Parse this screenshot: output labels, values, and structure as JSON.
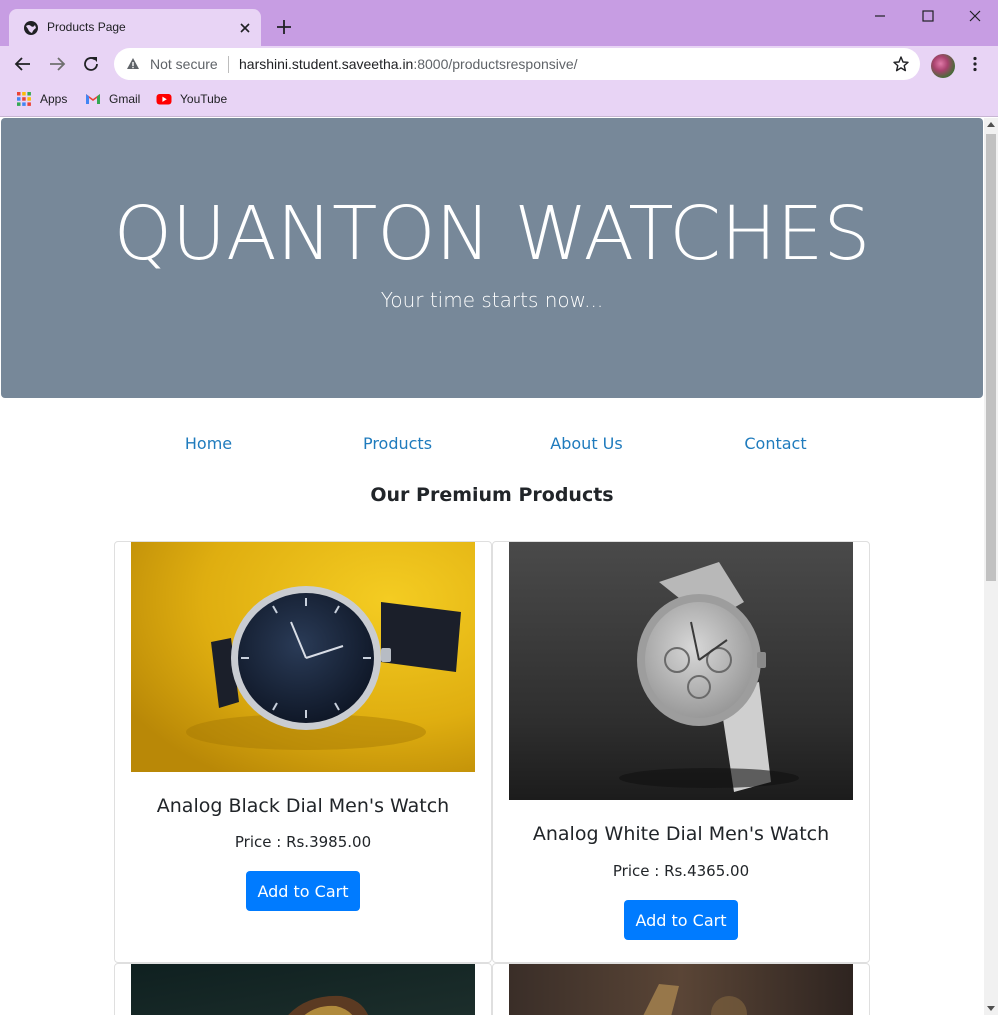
{
  "browser": {
    "tab_title": "Products Page",
    "security_label": "Not secure",
    "url_host": "harshini.student.saveetha.in",
    "url_rest": ":8000/productsresponsive/",
    "bookmarks": [
      {
        "label": "Apps",
        "icon": "apps-grid-icon"
      },
      {
        "label": "Gmail",
        "icon": "gmail-icon"
      },
      {
        "label": "YouTube",
        "icon": "youtube-icon"
      }
    ]
  },
  "hero": {
    "title": "QUANTON WATCHES",
    "subtitle": "Your time starts now..."
  },
  "nav": {
    "links": [
      "Home",
      "Products",
      "About Us",
      "Contact"
    ],
    "color": "#1f7bbd"
  },
  "section": {
    "title": "Our Premium Products"
  },
  "products": [
    {
      "name": "Analog Black Dial Men's Watch",
      "price": "Price : Rs.3985.00",
      "button": "Add to Cart"
    },
    {
      "name": "Analog White Dial Men's Watch",
      "price": "Price : Rs.4365.00",
      "button": "Add to Cart"
    }
  ],
  "colors": {
    "hero_bg": "#778899",
    "button_bg": "#007bff",
    "chrome_title": "#c79de3",
    "chrome_toolbar": "#e8d4f5"
  }
}
